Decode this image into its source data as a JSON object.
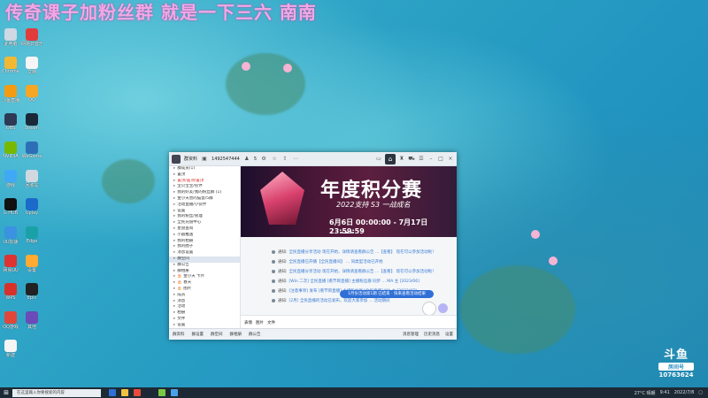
{
  "overlay": {
    "text": "传奇课子加粉丝群 就是一下三六 南南"
  },
  "desktop_icons": [
    {
      "label": "此电脑",
      "color": "#cfd8e3"
    },
    {
      "label": "网易云音乐",
      "color": "#e23b3b"
    },
    {
      "label": "Chrome",
      "color": "#f2b833"
    },
    {
      "label": "文档",
      "color": "#f5f5f5"
    },
    {
      "label": "斗鱼直播",
      "color": "#f39c12"
    },
    {
      "label": "QQ",
      "color": "#f5a623"
    },
    {
      "label": "OBS",
      "color": "#2e3a55"
    },
    {
      "label": "Steam",
      "color": "#1b2838"
    },
    {
      "label": "NVIDIA",
      "color": "#76b900"
    },
    {
      "label": "WeGame",
      "color": "#2d6fb7"
    },
    {
      "label": "游戏",
      "color": "#3fa9f5"
    },
    {
      "label": "回收站",
      "color": "#d0d8e0"
    },
    {
      "label": "G HUB",
      "color": "#111"
    },
    {
      "label": "Uplay",
      "color": "#1b6ac9"
    },
    {
      "label": "UU加速",
      "color": "#3a92e0"
    },
    {
      "label": "Edge",
      "color": "#1aa1a8"
    },
    {
      "label": "网易UU",
      "color": "#d33"
    },
    {
      "label": "设置",
      "color": "#ffaa33"
    },
    {
      "label": "WPS",
      "color": "#d7322a"
    },
    {
      "label": "Epic",
      "color": "#222"
    },
    {
      "label": "QQ游戏",
      "color": "#e0463a"
    },
    {
      "label": "其他",
      "color": "#6b4bb7"
    },
    {
      "label": "新建",
      "color": "#f5f5f5"
    }
  ],
  "qq_window": {
    "title": "群资料",
    "group_id": "1492547444",
    "member_count": "5",
    "sidebar_items": [
      {
        "label": "群成员(1)",
        "hl": false,
        "sel": false
      },
      {
        "label": "置顶",
        "hl": false,
        "sel": false
      },
      {
        "label": "置顶/置顶/置顶",
        "hl": true,
        "sel": false
      },
      {
        "label": "宝贝宝宝/伙伴",
        "hl": false,
        "sel": false
      },
      {
        "label": "我的好友/我的粉丝群 [1]",
        "hl": false,
        "sel": false
      },
      {
        "label": "金小天营的猫鼠/5群",
        "hl": false,
        "sel": false
      },
      {
        "label": "活动直播/小伙伴",
        "hl": false,
        "sel": false
      },
      {
        "label": "设置",
        "hl": false,
        "sel": false
      },
      {
        "label": "我的粉丝/管理",
        "hl": false,
        "sel": false
      },
      {
        "label": "全民充值中心",
        "hl": false,
        "sel": false
      },
      {
        "label": "星盘查询",
        "hl": false,
        "sel": false
      },
      {
        "label": "小圆推送",
        "hl": false,
        "sel": false
      },
      {
        "label": "我的相册",
        "hl": false,
        "sel": false
      },
      {
        "label": "我的圈子",
        "hl": false,
        "sel": false
      },
      {
        "label": "消息设置",
        "hl": false,
        "sel": false
      },
      {
        "label": "群空间",
        "hl": false,
        "sel": true
      },
      {
        "label": "群公告",
        "hl": false,
        "sel": false
      },
      {
        "label": "群相册",
        "hl": false,
        "sel": false
      },
      {
        "label": "🎂 金小天 卡片",
        "hl": false,
        "sel": false
      },
      {
        "label": "🎂 春天",
        "hl": false,
        "sel": false
      },
      {
        "label": "🎂 图片",
        "hl": false,
        "sel": false
      },
      {
        "label": "成员",
        "hl": false,
        "sel": false
      },
      {
        "label": "消息",
        "hl": false,
        "sel": false
      },
      {
        "label": "活动",
        "hl": false,
        "sel": false
      },
      {
        "label": "相册",
        "hl": false,
        "sel": false
      },
      {
        "label": "文件",
        "hl": false,
        "sel": false
      },
      {
        "label": "设置",
        "hl": false,
        "sel": false
      },
      {
        "label": "其它",
        "hl": false,
        "sel": false
      },
      {
        "label": "show",
        "hl": false,
        "sel": false
      }
    ],
    "banner": {
      "title": "年度积分赛",
      "subtitle": "2022支持 S3 一战成名",
      "date": "6月6日 00:00:00 - 7月17日 23:59:59"
    },
    "messages": [
      {
        "prefix": "通知:",
        "text": "全民直播分享活动 现在开始，详情请查看群公告 ...【查看】 现在可以参加活动啦！"
      },
      {
        "prefix": "通知:",
        "text": "全民直播已开播【全民直播间】 ... 同类型活动已开始"
      },
      {
        "prefix": "通知:",
        "text": "全民直播分享活动 现在开始，详情请查看群公告 ...【查看】 现在可以参加活动啦！"
      },
      {
        "prefix": "通知:",
        "text": "[Win 二次] 全民直播 [看节目直播] 主播粉丝群 同步 ... MA 主 [2023/06]"
      },
      {
        "prefix": "通知:",
        "text": "[注意事项] 发布 [看节目直播] 主播粉丝群 [全民直播] MA 主 [2023/07]"
      },
      {
        "prefix": "通知:",
        "text": "[2月] 全民直播的活动已发布，欢迎大家参加 ... 活动期间"
      }
    ],
    "toast": "1月份活动第1期 已结束 · 快来查看活动结果",
    "input_bar": [
      "表情",
      "图片",
      "文件"
    ],
    "bottom_bar": {
      "left": [
        "群资料",
        "群设置",
        "群空间",
        "群相册",
        "群公告"
      ],
      "right": [
        "消息管理",
        "历史消息",
        "设置"
      ]
    }
  },
  "taskbar": {
    "start_icon": "windows-icon",
    "search_placeholder": "在这里输入你要搜索的内容",
    "tray_temp": "27°C 晴朗",
    "tray_time": "9:41",
    "tray_date": "2022/7/8"
  },
  "douyu_logo": {
    "brand": "斗鱼",
    "room_label": "房间号",
    "room_number": "10763624"
  },
  "colors": {
    "accent": "#2f6fd6",
    "overlay": "#f3a8e6"
  }
}
